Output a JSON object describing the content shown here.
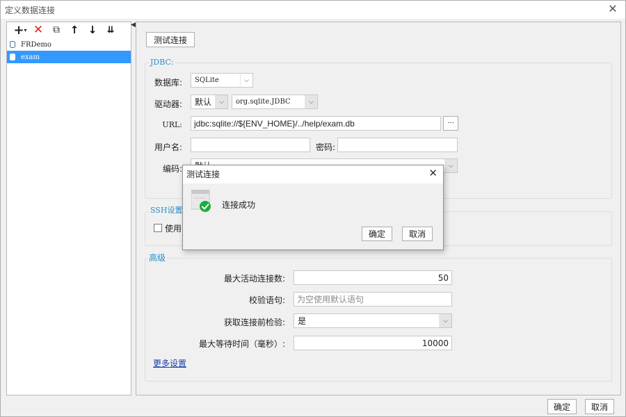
{
  "window": {
    "title": "定义数据连接"
  },
  "left": {
    "items": [
      {
        "label": "FRDemo"
      },
      {
        "label": "exam"
      }
    ]
  },
  "main": {
    "test_button": "测试连接",
    "jdbc": {
      "group_label": "JDBC:",
      "database_label": "数据库:",
      "database_value": "SQLite",
      "driver_label": "驱动器:",
      "driver_mode": "默认",
      "driver_class": "org.sqlite.JDBC",
      "url_label": "URL:",
      "url_value": "jdbc:sqlite://${ENV_HOME}/../help/exam.db",
      "url_more": "···",
      "username_label": "用户名:",
      "username_value": "",
      "password_label": "密码:",
      "password_value": "",
      "encoding_label": "编码:",
      "encoding_value": "默认"
    },
    "ssh": {
      "group_label": "SSH设置",
      "use_label": "使用"
    },
    "advanced": {
      "group_label": "高级",
      "max_active_label": "最大活动连接数:",
      "max_active_value": "50",
      "validation_label": "校验语句:",
      "validation_placeholder": "为空使用默认语句",
      "test_before_label": "获取连接前检验:",
      "test_before_value": "是",
      "max_wait_label": "最大等待时间（毫秒）:",
      "max_wait_value": "10000",
      "more_settings": "更多设置"
    }
  },
  "footer": {
    "ok": "确定",
    "cancel": "取消"
  },
  "modal": {
    "title": "测试连接",
    "message": "连接成功",
    "ok": "确定",
    "cancel": "取消"
  },
  "colors": {
    "selection": "#3399ff",
    "success": "#1aaf3c",
    "group_label": "#2a8ec4",
    "link": "#1a3ea8"
  }
}
